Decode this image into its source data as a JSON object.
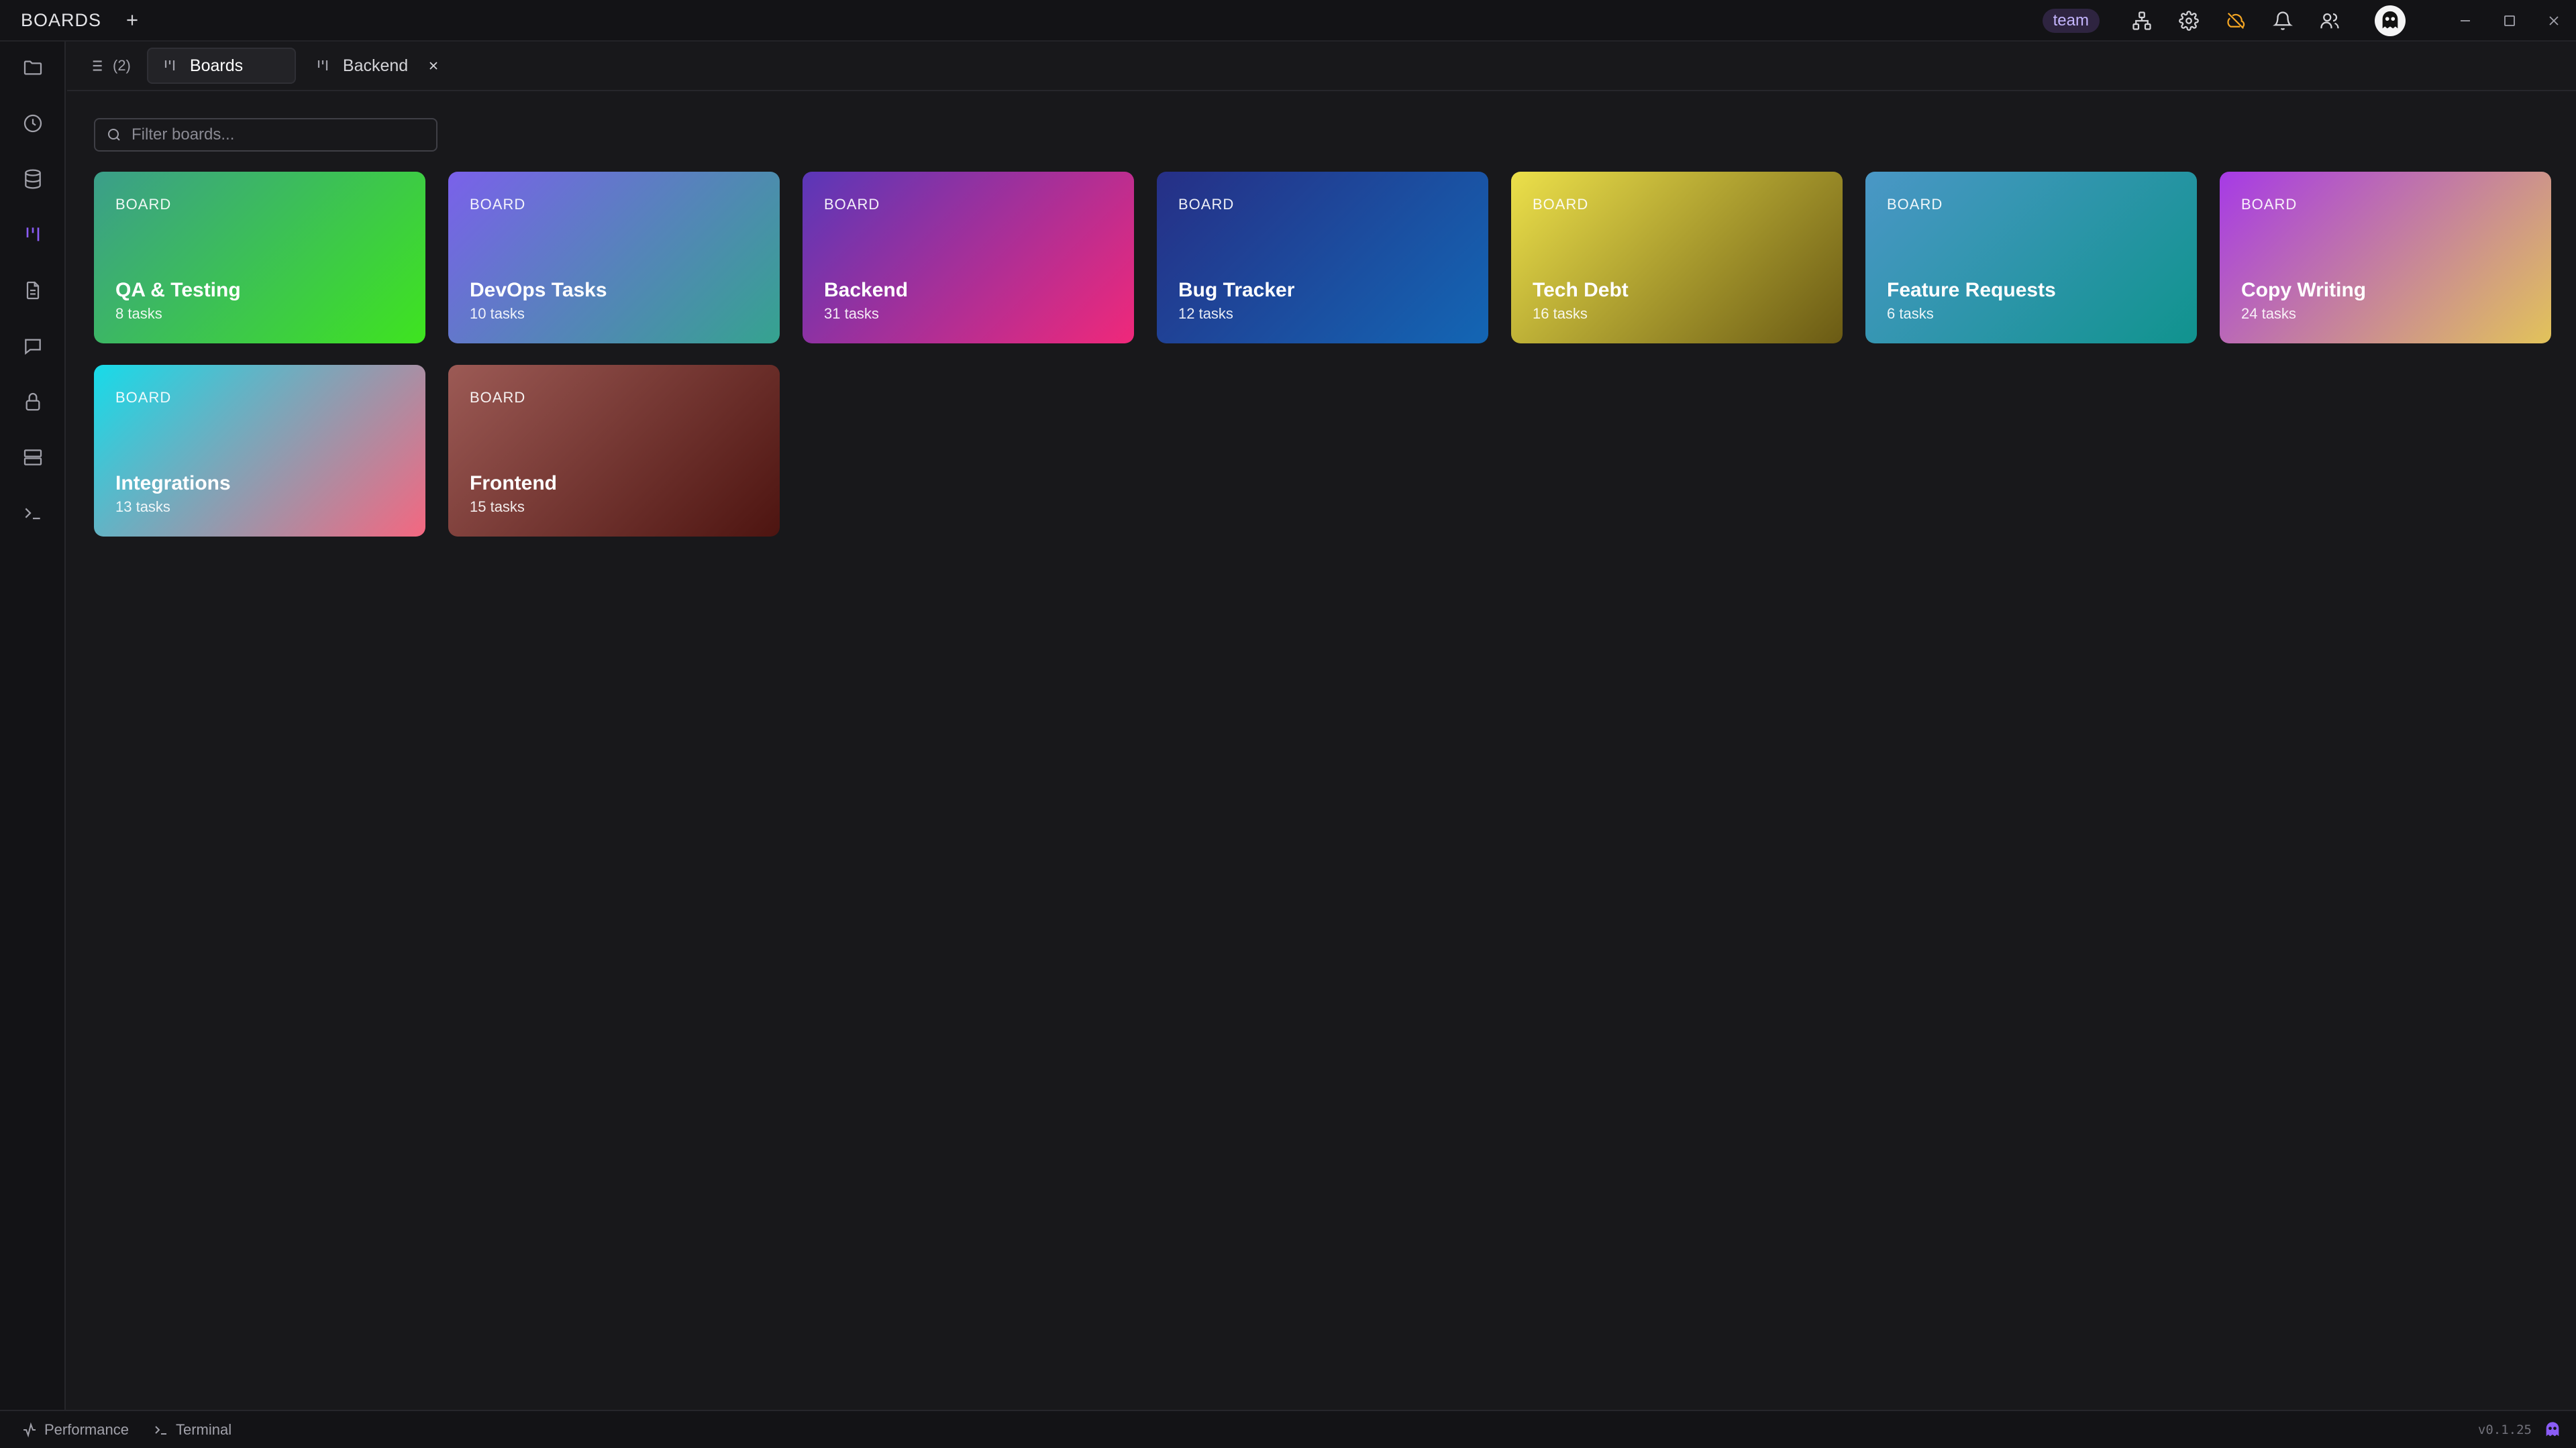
{
  "titlebar": {
    "title": "BOARDS",
    "team_badge": "team"
  },
  "tabs": {
    "list_count": "(2)",
    "items": [
      {
        "label": "Boards",
        "active": true
      },
      {
        "label": "Backend",
        "active": false
      }
    ]
  },
  "filter": {
    "placeholder": "Filter boards..."
  },
  "boards": [
    {
      "kind": "BOARD",
      "name": "QA & Testing",
      "count": "8 tasks",
      "gradient": [
        "#3b9e8a",
        "#3ee41f"
      ]
    },
    {
      "kind": "BOARD",
      "name": "DevOps Tasks",
      "count": "10 tasks",
      "gradient": [
        "#7a61ea",
        "#35a38f"
      ]
    },
    {
      "kind": "BOARD",
      "name": "Backend",
      "count": "31 tasks",
      "gradient": [
        "#5a37b8",
        "#f0287a"
      ]
    },
    {
      "kind": "BOARD",
      "name": "Bug Tracker",
      "count": "12 tasks",
      "gradient": [
        "#262f86",
        "#1366b4"
      ]
    },
    {
      "kind": "BOARD",
      "name": "Tech Debt",
      "count": "16 tasks",
      "gradient": [
        "#ece04a",
        "#6a5a14"
      ]
    },
    {
      "kind": "BOARD",
      "name": "Feature Requests",
      "count": "6 tasks",
      "gradient": [
        "#4a97c6",
        "#10938e"
      ]
    },
    {
      "kind": "BOARD",
      "name": "Copy Writing",
      "count": "24 tasks",
      "gradient": [
        "#a63ae6",
        "#e2c35a"
      ]
    },
    {
      "kind": "BOARD",
      "name": "Integrations",
      "count": "13 tasks",
      "gradient": [
        "#17dbe9",
        "#f46780"
      ]
    },
    {
      "kind": "BOARD",
      "name": "Frontend",
      "count": "15 tasks",
      "gradient": [
        "#9c5a55",
        "#4d1410"
      ]
    }
  ],
  "statusbar": {
    "performance": "Performance",
    "terminal": "Terminal",
    "version": "v0.1.25"
  },
  "colors": {
    "accent": "#8b5cf6",
    "warning": "#f5a623",
    "background": "#18181b"
  }
}
